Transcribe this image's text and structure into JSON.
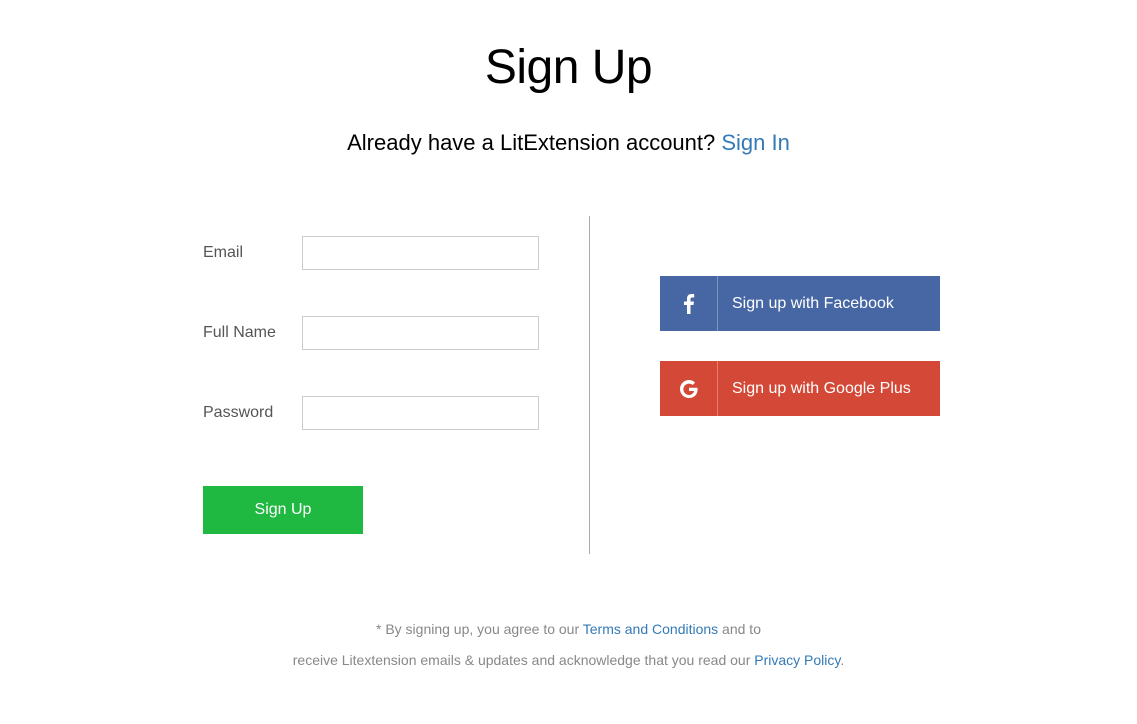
{
  "title": "Sign Up",
  "subtitle": {
    "text": "Already have a LitExtension account? ",
    "link": "Sign In"
  },
  "form": {
    "email_label": "Email",
    "fullname_label": "Full Name",
    "password_label": "Password",
    "submit_label": "Sign Up"
  },
  "social": {
    "facebook": "Sign up with Facebook",
    "google": "Sign up with Google Plus"
  },
  "footer": {
    "line1_pre": "* By signing up, you agree to our ",
    "terms_link": "Terms and Conditions",
    "line1_post": " and to",
    "line2_pre": "receive Litextension emails & updates and acknowledge that you read our ",
    "privacy_link": "Privacy Policy",
    "line2_post": "."
  }
}
